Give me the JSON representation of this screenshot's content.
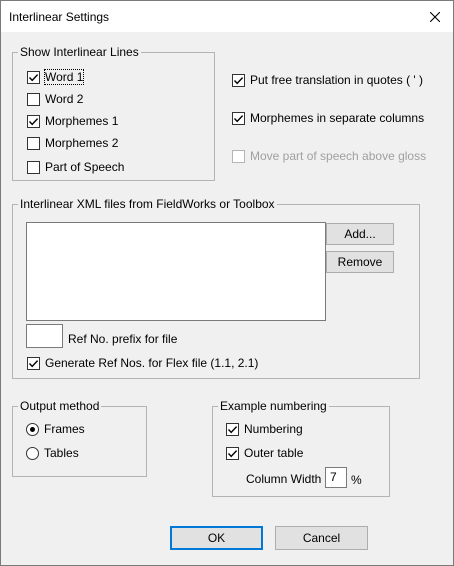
{
  "window": {
    "title": "Interlinear Settings",
    "close_glyph": "✕"
  },
  "show_lines": {
    "legend": "Show Interlinear Lines",
    "items": [
      {
        "label": "Word 1",
        "checked": true
      },
      {
        "label": "Word 2",
        "checked": false
      },
      {
        "label": "Morphemes 1",
        "checked": true
      },
      {
        "label": "Morphemes 2",
        "checked": false
      },
      {
        "label": "Part of Speech",
        "checked": false
      }
    ]
  },
  "right_options": [
    {
      "label": "Put free translation in quotes ( ' )",
      "checked": true,
      "disabled": false
    },
    {
      "label": "Morphemes in separate columns",
      "checked": true,
      "disabled": false
    },
    {
      "label": "Move part of speech above gloss",
      "checked": false,
      "disabled": true
    }
  ],
  "xml_files": {
    "legend": "Interlinear XML files from FieldWorks or Toolbox",
    "add_label": "Add...",
    "remove_label": "Remove",
    "ref_prefix_value": "",
    "ref_prefix_label": "Ref No. prefix for file",
    "generate_label": "Generate Ref Nos. for Flex file (1.1, 2.1)",
    "generate_checked": true
  },
  "output_method": {
    "legend": "Output method",
    "options": [
      {
        "label": "Frames",
        "selected": true
      },
      {
        "label": "Tables",
        "selected": false
      }
    ]
  },
  "example_numbering": {
    "legend": "Example numbering",
    "numbering_label": "Numbering",
    "numbering_checked": true,
    "outer_table_label": "Outer table",
    "outer_table_checked": true,
    "column_width_label": "Column Width",
    "column_width_value": "7",
    "percent_sign": "%"
  },
  "buttons": {
    "ok": "OK",
    "cancel": "Cancel"
  }
}
